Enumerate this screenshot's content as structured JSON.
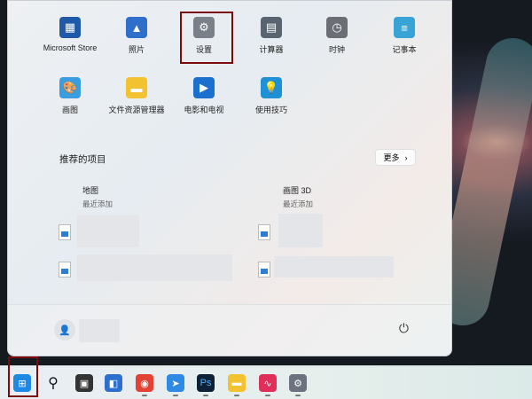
{
  "pinned": [
    {
      "label": "Microsoft Store",
      "icon": "store-icon",
      "color": "#1e5aa8"
    },
    {
      "label": "照片",
      "icon": "photos-icon",
      "color": "#2f6fc9"
    },
    {
      "label": "设置",
      "icon": "gear-icon",
      "color": "#7a8088"
    },
    {
      "label": "计算器",
      "icon": "calculator-icon",
      "color": "#5a6470"
    },
    {
      "label": "时钟",
      "icon": "clock-icon",
      "color": "#6b6f75"
    },
    {
      "label": "记事本",
      "icon": "notepad-icon",
      "color": "#3aa3d6"
    },
    {
      "label": "画图",
      "icon": "paint-icon",
      "color": "#3a9de0"
    },
    {
      "label": "文件资源管理器",
      "icon": "folder-icon",
      "color": "#f2c230"
    },
    {
      "label": "电影和电视",
      "icon": "movies-icon",
      "color": "#1b6fcf"
    },
    {
      "label": "使用技巧",
      "icon": "tips-icon",
      "color": "#1e90d6"
    }
  ],
  "recommended": {
    "title": "推荐的项目",
    "more": "更多",
    "items": [
      {
        "name": "地图",
        "sub": "最近添加"
      },
      {
        "name": "画图 3D",
        "sub": "最近添加"
      }
    ]
  },
  "taskbar": [
    {
      "icon": "windows-start-icon"
    },
    {
      "icon": "search-icon"
    },
    {
      "icon": "task-view-icon"
    },
    {
      "icon": "widgets-icon"
    },
    {
      "icon": "chrome-icon"
    },
    {
      "icon": "feishu-icon"
    },
    {
      "icon": "photoshop-icon",
      "text": "Ps"
    },
    {
      "icon": "file-explorer-icon"
    },
    {
      "icon": "app-icon"
    },
    {
      "icon": "settings-icon"
    }
  ]
}
